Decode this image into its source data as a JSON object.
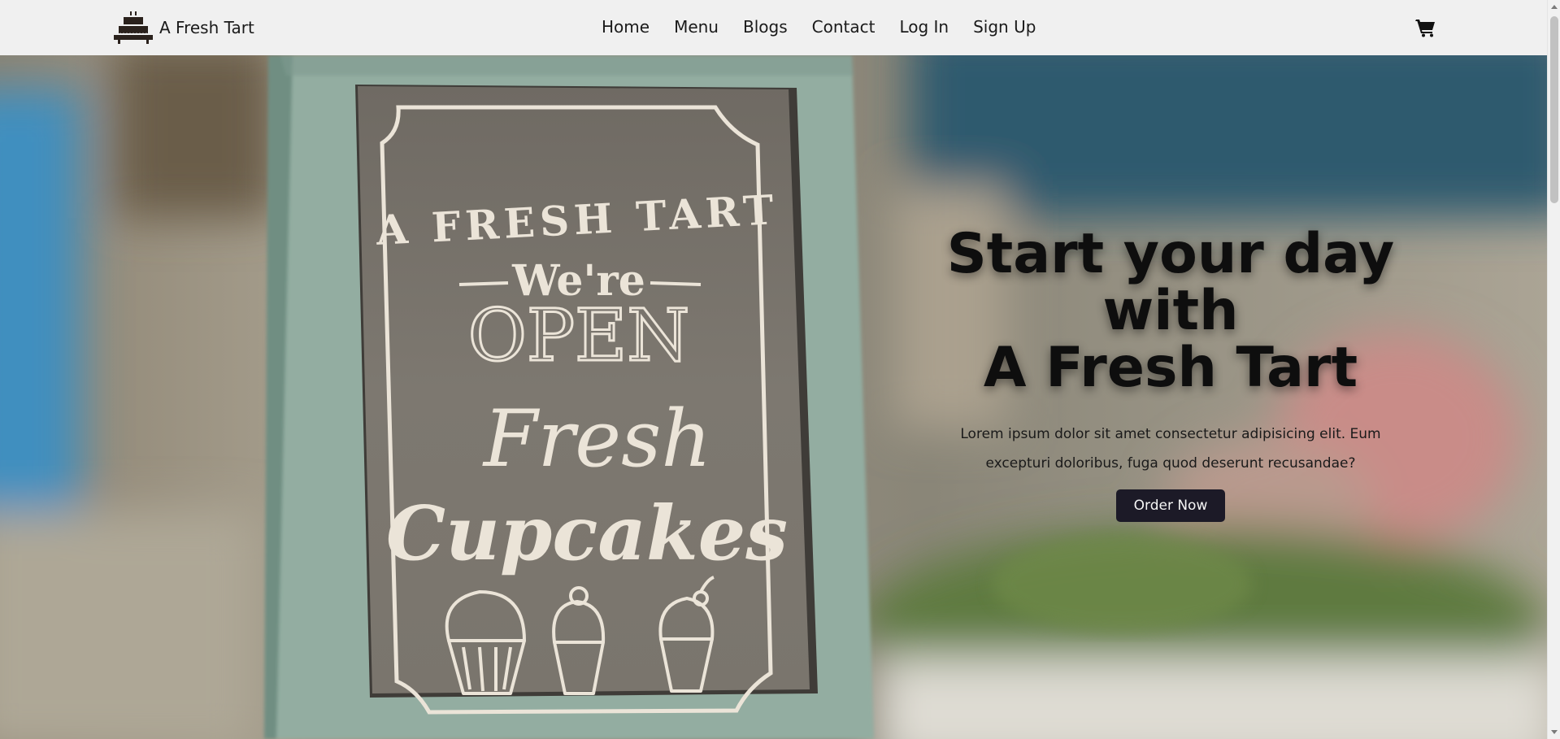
{
  "brand": {
    "name": "A Fresh Tart",
    "logo_icon": "cake-stand-icon"
  },
  "nav": {
    "links": [
      "Home",
      "Menu",
      "Blogs",
      "Contact",
      "Log In",
      "Sign Up"
    ],
    "cart_icon": "cart-icon"
  },
  "hero": {
    "title_line1": "Start your day",
    "title_line2": "with",
    "title_line3": "A Fresh Tart",
    "subtitle": "Lorem ipsum dolor sit amet consectetur adipisicing elit. Eum excepturi doloribus, fuga quod deserunt recusandae?",
    "cta_label": "Order Now"
  },
  "sign": {
    "top_text": "A FRESH TART",
    "line1": "We're",
    "line2": "OPEN",
    "line3": "Fresh",
    "line4": "Cupcakes"
  },
  "colors": {
    "navbar_bg": "#f0f0f0",
    "button_bg": "#1c1a27",
    "sign_frame": "#93ada1",
    "chalkboard": "#7b766e"
  }
}
